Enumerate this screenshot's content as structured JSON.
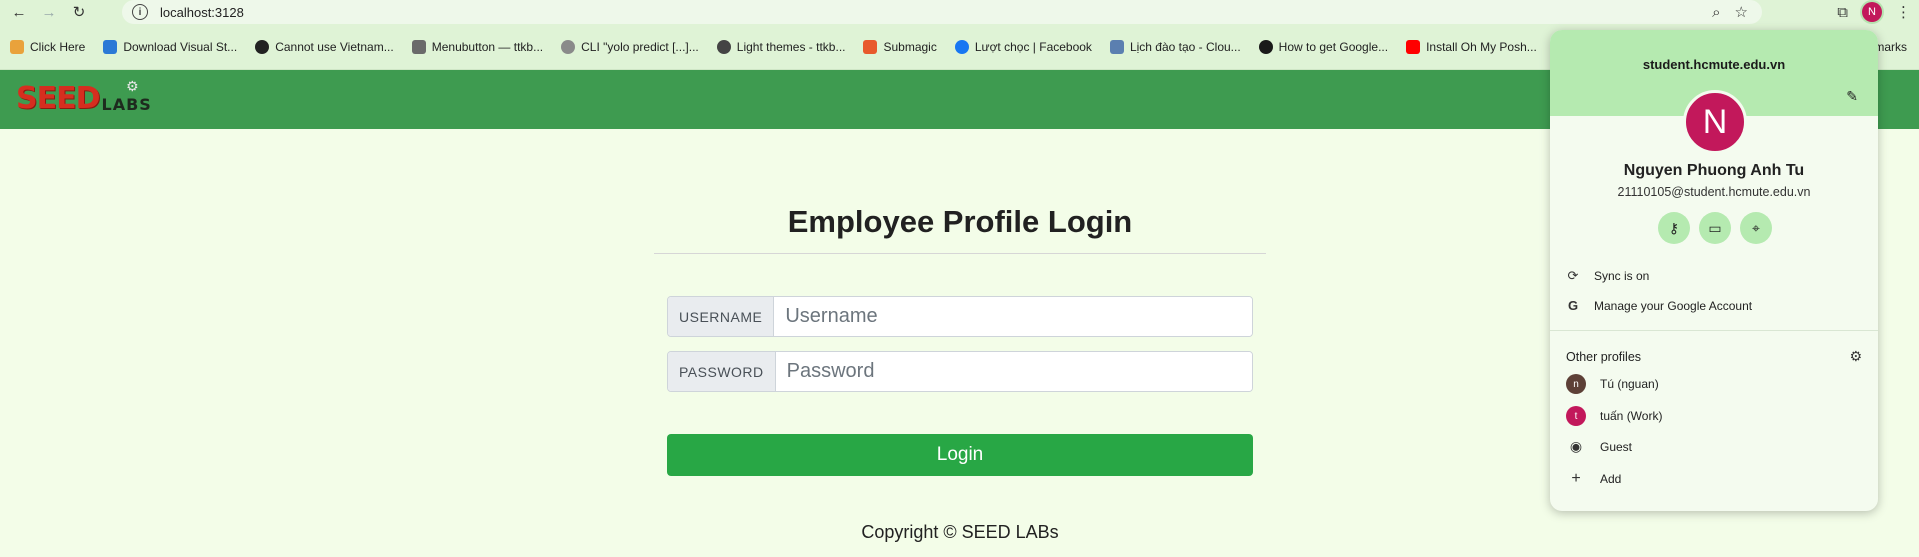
{
  "browser": {
    "url": "localhost:3128",
    "bookmarks": [
      {
        "label": "Click Here",
        "color": "#e9a23b"
      },
      {
        "label": "Download Visual St...",
        "color": "#2b79d6"
      },
      {
        "label": "Cannot use Vietnam...",
        "color": "#222222"
      },
      {
        "label": "Menubutton — ttkb...",
        "color": "#6a6a6a"
      },
      {
        "label": "CLI \"yolo predict [...]...",
        "color": "#8a8a8a"
      },
      {
        "label": "Light themes - ttkb...",
        "color": "#444444"
      },
      {
        "label": "Submagic",
        "color": "#e8592c"
      },
      {
        "label": "Lượt chọc | Facebook",
        "color": "#1877f2"
      },
      {
        "label": "Lịch đào tạo - Clou...",
        "color": "#5b7fb0"
      },
      {
        "label": "How to get Google...",
        "color": "#1a1a1a"
      },
      {
        "label": "Install Oh My Posh...",
        "color": "#ff0000"
      }
    ],
    "bookmarks_overflow": "marks",
    "profile_initial": "N"
  },
  "site": {
    "logo_main": "SEED",
    "logo_sub": "LABS"
  },
  "login": {
    "title": "Employee Profile Login",
    "username_label": "USERNAME",
    "username_placeholder": "Username",
    "password_label": "PASSWORD",
    "password_placeholder": "Password",
    "button": "Login",
    "copyright": "Copyright © SEED LABs"
  },
  "profile_menu": {
    "domain": "student.hcmute.edu.vn",
    "avatar_initial": "N",
    "name": "Nguyen Phuong Anh Tu",
    "email": "21110105@student.hcmute.edu.vn",
    "sync": "Sync is on",
    "manage": "Manage your Google Account",
    "other_profiles_title": "Other profiles",
    "profiles": [
      {
        "initial": "n",
        "label": "Tú (nguan)",
        "color": "#5d4037"
      },
      {
        "initial": "t",
        "label": "tuấn (Work)",
        "color": "#c2185b"
      }
    ],
    "guest": "Guest",
    "add": "Add"
  }
}
